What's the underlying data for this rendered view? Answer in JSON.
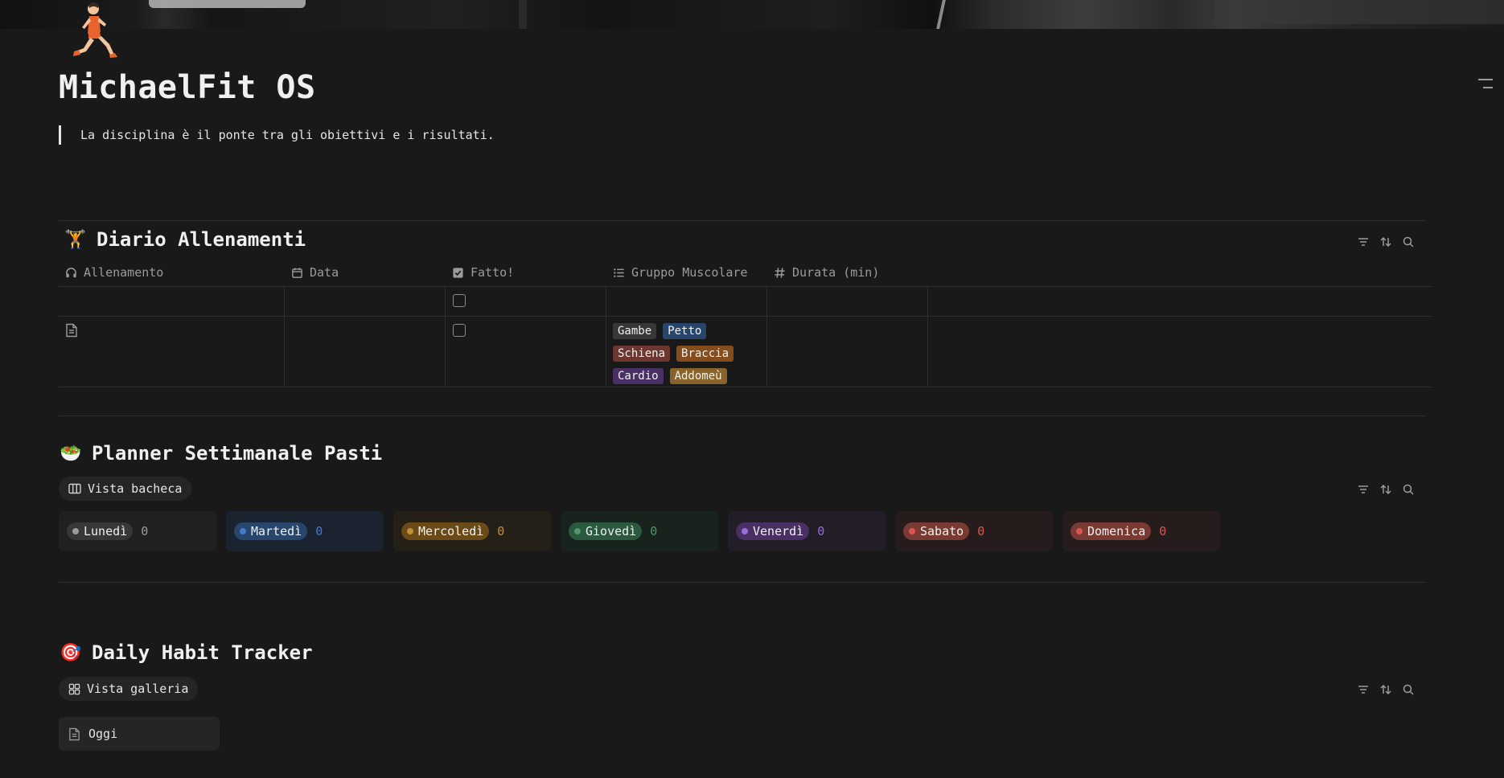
{
  "page": {
    "title": "MichaelFit OS",
    "quote": "La disciplina è il ponte tra gli obiettivi e i risultati."
  },
  "icons": {
    "page_icon": "runner-icon",
    "toc": "table-of-contents-icon",
    "filter": "filter-icon",
    "sort": "sort-icon",
    "search": "search-icon"
  },
  "workouts": {
    "emoji": "🏋",
    "title": "Diario Allenamenti",
    "columns": [
      {
        "label": "Allenamento",
        "icon": "headphones-icon"
      },
      {
        "label": "Data",
        "icon": "calendar-icon"
      },
      {
        "label": "Fatto!",
        "icon": "checkbox-icon"
      },
      {
        "label": "Gruppo Muscolare",
        "icon": "list-icon"
      },
      {
        "label": "Durata (min)",
        "icon": "hash-icon"
      }
    ],
    "rows": [
      {
        "has_page_icon": false,
        "done": false,
        "tags": []
      },
      {
        "has_page_icon": true,
        "done": false,
        "tags": [
          {
            "label": "Gambe",
            "color": "#373737"
          },
          {
            "label": "Petto",
            "color": "#28456c"
          },
          {
            "label": "Schiena",
            "color": "#6e3630"
          },
          {
            "label": "Braccia",
            "color": "#854c1d"
          },
          {
            "label": "Cardio",
            "color": "#492f64"
          },
          {
            "label": "Addomeù",
            "color": "#89632a"
          }
        ]
      }
    ]
  },
  "meals": {
    "emoji": "🥗",
    "title": "Planner Settimanale Pasti",
    "view_label": "Vista bacheca",
    "columns": [
      {
        "label": "Lunedì",
        "count": "0",
        "pill": "#373737",
        "dot": "#9b9b9b",
        "bg": "#202020",
        "count_color": "#9b9b9b"
      },
      {
        "label": "Martedì",
        "count": "0",
        "pill": "#28456c",
        "dot": "#447acb",
        "bg": "#1b2230",
        "count_color": "#447acb"
      },
      {
        "label": "Mercoledì",
        "count": "0",
        "pill": "#6a4b17",
        "dot": "#c19138",
        "bg": "#241f17",
        "count_color": "#c19138"
      },
      {
        "label": "Giovedì",
        "count": "0",
        "pill": "#2b593f",
        "dot": "#4f9768",
        "bg": "#18231d",
        "count_color": "#4f9768"
      },
      {
        "label": "Venerdì",
        "count": "0",
        "pill": "#492f64",
        "dot": "#9a6dd7",
        "bg": "#221d27",
        "count_color": "#9a6dd7"
      },
      {
        "label": "Sabato",
        "count": "0",
        "pill": "#7a3a34",
        "dot": "#de5550",
        "bg": "#261c1b",
        "count_color": "#de5550"
      },
      {
        "label": "Domenica",
        "count": "0",
        "pill": "#7a3a34",
        "dot": "#de5550",
        "bg": "#261c1b",
        "count_color": "#de5550"
      }
    ]
  },
  "habits": {
    "emoji": "🎯",
    "title": "Daily Habit Tracker",
    "view_label": "Vista galleria",
    "cards": [
      {
        "label": "Oggi"
      }
    ]
  }
}
